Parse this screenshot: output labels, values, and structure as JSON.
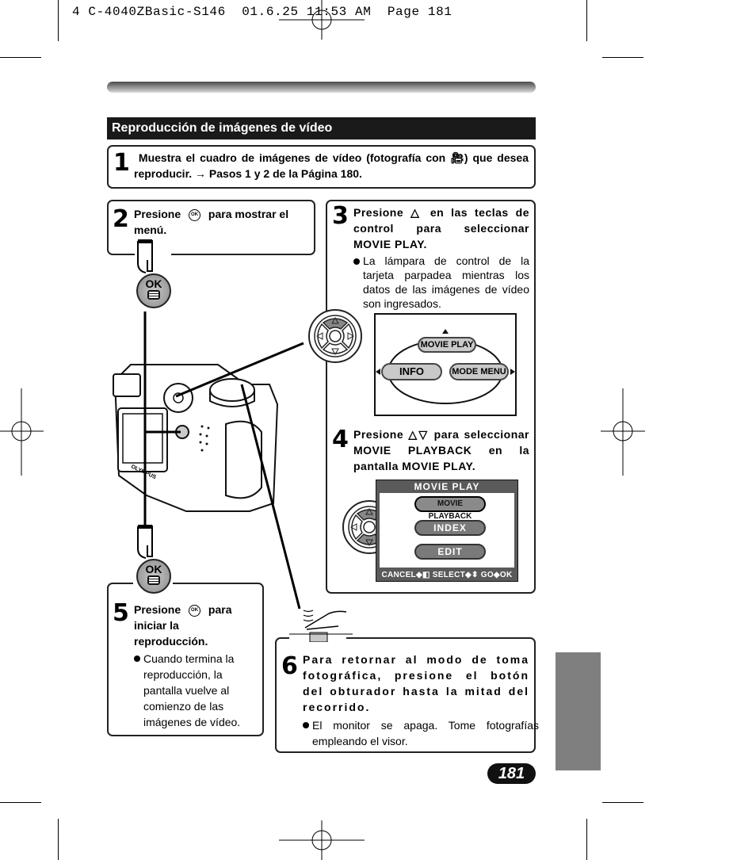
{
  "print_header": "4 C-4040ZBasic-S146  01.6.25 11:53 AM  Page 181",
  "section_title": "Reproducción de imágenes de vídeo",
  "steps": [
    {
      "number": "1",
      "text": "Muestra el cuadro de imágenes de vídeo (fotografía con",
      "icon": "movie-camera-icon",
      "text_after_icon": ") que desea reproducir. → Pasos 1 y 2 de la Página 180."
    },
    {
      "number": "2",
      "text_before_icon": "Presione",
      "icon": "ok-button-icon",
      "text_after_icon": "para mostrar el menú."
    },
    {
      "number": "3",
      "text_before_icon": "Presione △ en las teclas de control para seleccionar MOVIE PLAY.",
      "bullet": "La lámpara de control de la tarjeta parpadea mientras los datos de las imágenes de vídeo son ingresados."
    },
    {
      "number": "4",
      "text": "Presione △▽ para seleccionar MOVIE PLAYBACK en la pantalla MOVIE PLAY."
    },
    {
      "number": "5",
      "text_before_icon": "Presione",
      "icon": "ok-button-icon",
      "text_after_icon": "para iniciar la reproducción.",
      "bullet": "Cuando termina la reproducción, la pantalla vuelve al comienzo de las imágenes de vídeo."
    },
    {
      "number": "6",
      "text": "Para retornar al modo de toma fotográfica, presione el botón del obturador hasta la mitad del recorrido.",
      "bullet": "El monitor se apaga. Tome fotografías empleando el visor."
    }
  ],
  "ok_button": {
    "label": "OK"
  },
  "screen_menu": {
    "top": "MOVIE PLAY",
    "left": "INFO",
    "right": "MODE MENU"
  },
  "screen_movie_play": {
    "title": "MOVIE PLAY",
    "items": [
      "MOVIE PLAYBACK",
      "INDEX",
      "EDIT"
    ],
    "selected": "MOVIE PLAYBACK",
    "footer": "CANCEL◆◧  SELECT◆⬍  GO◆OK"
  },
  "camera_brand": "OLYMPUS",
  "page_number": "181"
}
